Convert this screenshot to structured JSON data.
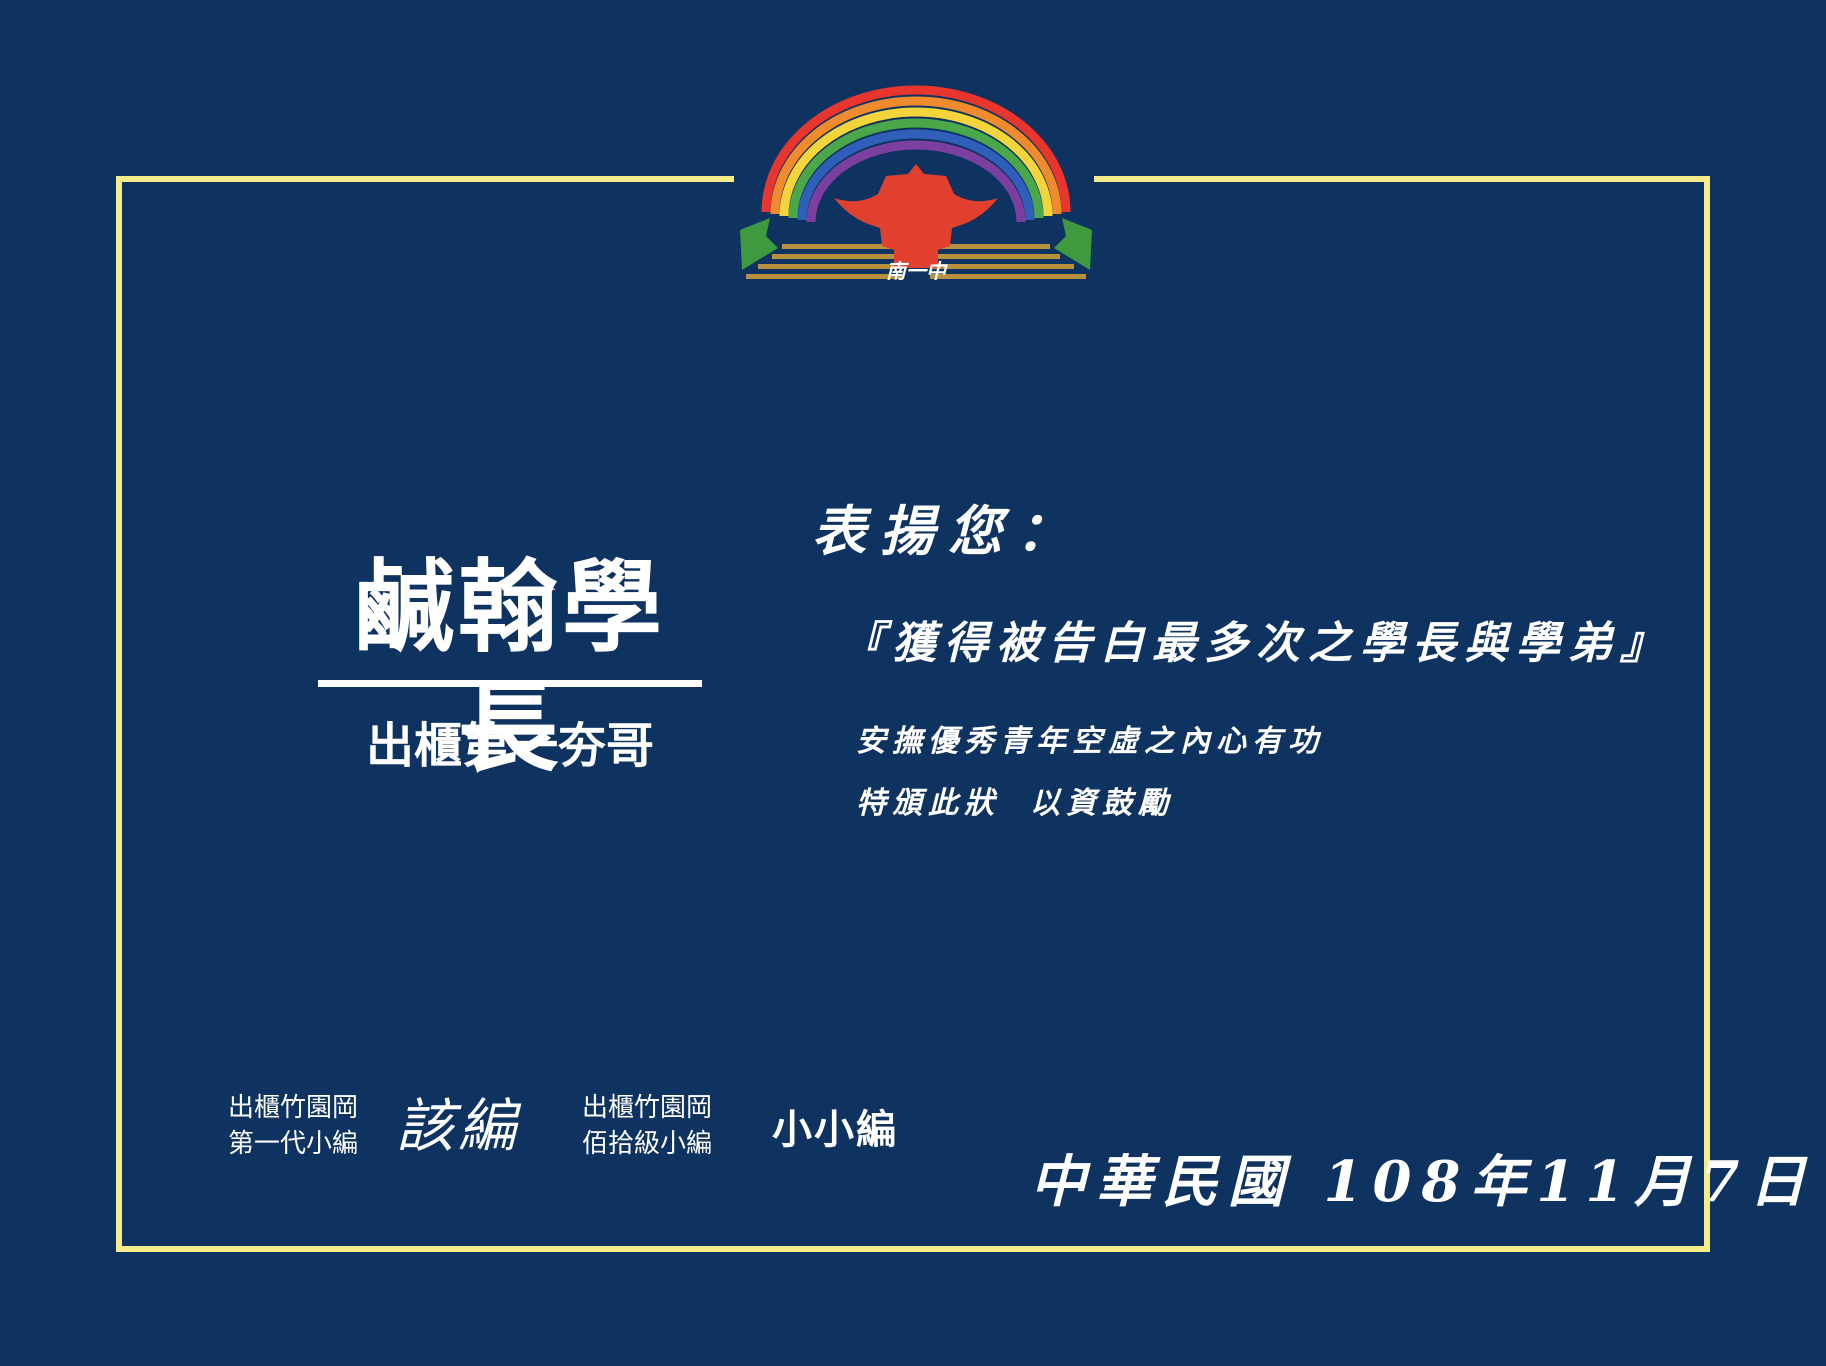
{
  "certificate": {
    "logo_text": "南一中",
    "recipient": {
      "name": "鹹翰學長",
      "title": "出櫃第一夯哥"
    },
    "commendation_heading": "表揚您：",
    "award_title": "『獲得被告白最多次之學長與學弟』",
    "reason_line1": "安撫優秀青年空虛之內心有功",
    "reason_line2a": "特頒此狀",
    "reason_line2b": "以資鼓勵",
    "issuers": [
      {
        "org": "出櫃竹園岡",
        "role": "第一代小編",
        "signature": "該編"
      },
      {
        "org": "出櫃竹園岡",
        "role": "佰拾級小編",
        "signature": "小小編"
      }
    ],
    "date": "中華民國 108年11月7日"
  },
  "colors": {
    "background": "#0f3360",
    "frame": "#f6ec8a",
    "text": "#ffffff",
    "logo_pagoda": "#e2402f",
    "logo_leaves": "#3f9a3f",
    "logo_base": "#b9903d"
  }
}
